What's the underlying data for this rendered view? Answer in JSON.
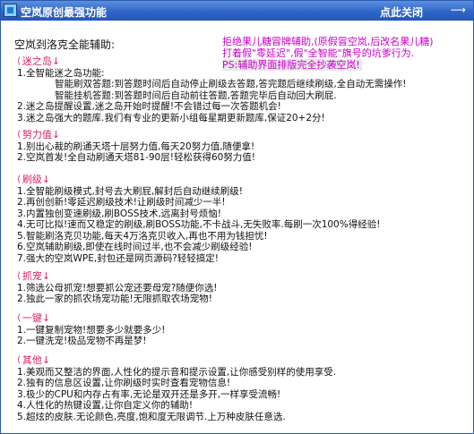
{
  "window": {
    "title": "空岚原创最强功能",
    "close_label": "点此关闭",
    "close_arrow": "⟶"
  },
  "heading": "空岚刭洛克全能辅助:",
  "notice": [
    "拒绝果儿糖冒牌辅助,(原假冒空岚,后改名果儿糖)",
    "打着假\"零延迟\",假\"全智能\"旗号的坑爹行为.",
    "PS:辅助界面排版完全抄袭空岚!"
  ],
  "sections": [
    {
      "title": "迷之岛",
      "items": [
        {
          "text": "1.全智能迷之岛功能:"
        },
        {
          "text": "智能刷双答题:到答题时间后自动停止刷级去答题,答完题后继续刷级,全自动无需操作!",
          "sub": 1
        },
        {
          "text": "智能挂机答题:到答题时间后自动前往答题,答题完毕后自动回大刷屁.",
          "sub": 1
        },
        {
          "text": "2.迷之岛提醒设置,迷之岛开始时提醒!不会错过每一次答题机会!"
        },
        {
          "text": "3.迷之岛强大的题库.我们有专业的更新小组每星期更新题库,保证20+2分!"
        }
      ]
    },
    {
      "title": "努力值",
      "items": [
        {
          "text": "1.别出心裁的刷通天塔十层努力值,每天20努力值,随便拿!"
        },
        {
          "text": "2.空岚首发!全自动刷通天塔81-90层!轻松获得60努力值!"
        }
      ]
    },
    {
      "title": "刷级",
      "items": [
        {
          "text": "1.全智能刷级模式,封号去大刷屁,解封后自动继续刷级!"
        },
        {
          "text": "2.再创创新!零延迟刷级技术!让刷级时间减少一半!"
        },
        {
          "text": "3.内置独创变速刷级,刷BOSS技术,远离封号烦恼!"
        },
        {
          "text": "4.无可比拟!速而又稳定的刷级,刷BOSS功能,不卡战斗,无失败率.每刷一次100%得经验!"
        },
        {
          "text": "5.智能刷洛克贝功能,每天4万洛克贝收入,再也不用为钱担忧!"
        },
        {
          "text": "6.空岚辅助刷级,即使在线时间过半,也不会减少刷级经验!"
        },
        {
          "text": "7.强大的空岚WPE,封包还是网页源码?轻轻搞定!"
        }
      ]
    },
    {
      "title": "抓宠",
      "items": [
        {
          "text": "1.筛选公母抓宠!想要抓公宠还要母宠?随便你选!"
        },
        {
          "text": "2.独此一家的抓农场宠功能!无限抓取农场宠物!"
        }
      ]
    },
    {
      "title": "一键",
      "items": [
        {
          "text": "1.一键复制宠物!想要多少就要多少!"
        },
        {
          "text": "2.一键洗宠!极品宠物不再是梦!"
        }
      ]
    },
    {
      "title": "其他",
      "items": [
        {
          "text": "1.美观而又整洁的界面,人性化的提示音和提示设置,让你感受别样的使用享受."
        },
        {
          "text": "2.独有的信息区设置,让你刷级时实时查看宠物信息!"
        },
        {
          "text": "3.极少的CPU和内存占有率,无论是双开还是多开,一样享受流畅!"
        },
        {
          "text": "4.人性化的热键设置,让你自定义你的辅助!"
        },
        {
          "text": "5.超炫的皮肤.无论颜色,亮度,饱和度无限调节.上万种皮肤任意选."
        }
      ]
    }
  ]
}
